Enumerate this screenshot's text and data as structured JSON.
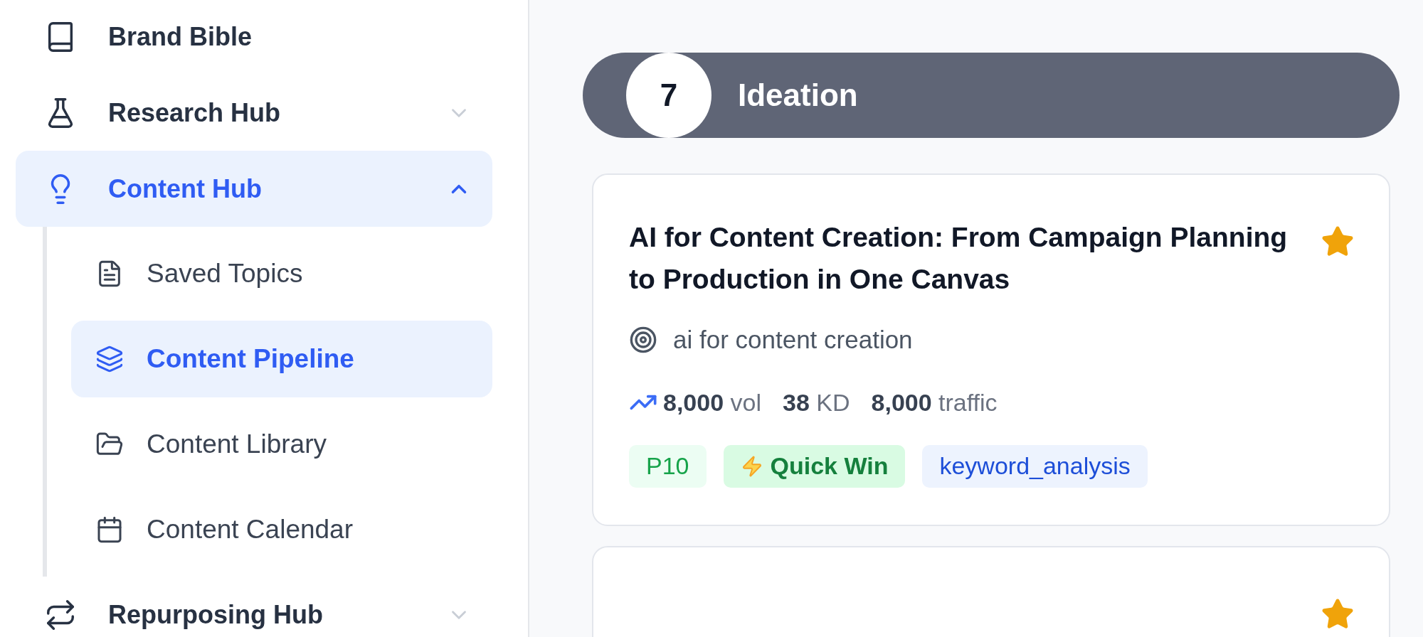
{
  "sidebar": {
    "items": [
      {
        "label": "Brand Bible",
        "selected": false
      },
      {
        "label": "Research Hub",
        "selected": false,
        "expanded": false
      },
      {
        "label": "Content Hub",
        "selected": true,
        "expanded": true,
        "children": [
          {
            "label": "Saved Topics",
            "selected": false
          },
          {
            "label": "Content Pipeline",
            "selected": true
          },
          {
            "label": "Content Library",
            "selected": false
          },
          {
            "label": "Content Calendar",
            "selected": false
          }
        ]
      },
      {
        "label": "Repurposing Hub",
        "selected": false,
        "expanded": false
      }
    ]
  },
  "pipeline": {
    "stage": {
      "count": "7",
      "title": "Ideation"
    },
    "cards": [
      {
        "title": "AI for Content Creation: From Campaign Planning to Production in One Canvas",
        "starred": true,
        "keyword": "ai for content creation",
        "stats": [
          {
            "value": "8,000",
            "unit": "vol"
          },
          {
            "value": "38",
            "unit": "KD"
          },
          {
            "value": "8,000",
            "unit": "traffic"
          }
        ],
        "tags": [
          {
            "label": "P10",
            "kind": "priority"
          },
          {
            "label": "Quick Win",
            "kind": "quick_win"
          },
          {
            "label": "keyword_analysis",
            "kind": "source"
          }
        ]
      },
      {
        "starred": true
      }
    ]
  }
}
